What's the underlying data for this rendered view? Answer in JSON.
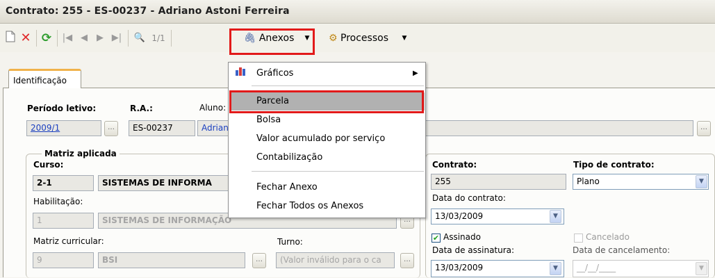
{
  "window": {
    "title": "Contrato: 255 - ES-00237 - Adriano Astoni Ferreira"
  },
  "toolbar": {
    "page_indicator": "1/1",
    "anexos_label": "Anexos",
    "processos_label": "Processos"
  },
  "tabs": [
    {
      "label": "Identificação",
      "active": true
    }
  ],
  "form": {
    "periodo_label": "Período letivo:",
    "periodo_value": "2009/1",
    "ra_label": "R.A.:",
    "ra_value": "ES-00237",
    "aluno_label": "Aluno:",
    "aluno_value": "Adriano",
    "matriz_group_title": "Matriz aplicada",
    "curso_label": "Curso:",
    "curso_code": "2-1",
    "curso_name": "SISTEMAS DE INFORMA",
    "habilitacao_label": "Habilitação:",
    "habilitacao_code": "1",
    "habilitacao_name": "SISTEMAS DE INFORMAÇÃO",
    "matriz_label": "Matriz curricular:",
    "matriz_code": "9",
    "matriz_name": "BSI",
    "turno_label": "Turno:",
    "turno_value": "(Valor inválido para o ca",
    "contrato_label": "Contrato:",
    "contrato_value": "255",
    "tipo_label": "Tipo de contrato:",
    "tipo_value": "Plano",
    "data_contrato_label": "Data do contrato:",
    "data_contrato_value": "13/03/2009",
    "assinado_label": "Assinado",
    "assinado_checked": true,
    "cancelado_label": "Cancelado",
    "cancelado_checked": false,
    "data_assinatura_label": "Data de assinatura:",
    "data_assinatura_value": "13/03/2009",
    "data_cancelamento_label": "Data de cancelamento:",
    "data_cancelamento_value": "__/__/____"
  },
  "menu": {
    "items": [
      {
        "label": "Gráficos",
        "submenu": true
      },
      {
        "label": "Parcela",
        "highlighted": true
      },
      {
        "label": "Bolsa"
      },
      {
        "label": "Valor acumulado por serviço"
      },
      {
        "label": "Contabilização"
      },
      {
        "label": "Fechar Anexo"
      },
      {
        "label": "Fechar Todos os Anexos"
      }
    ]
  },
  "colors": {
    "highlight_border": "#e21a1a",
    "link": "#1a3fc0",
    "tab_accent": "#f0b24a"
  }
}
